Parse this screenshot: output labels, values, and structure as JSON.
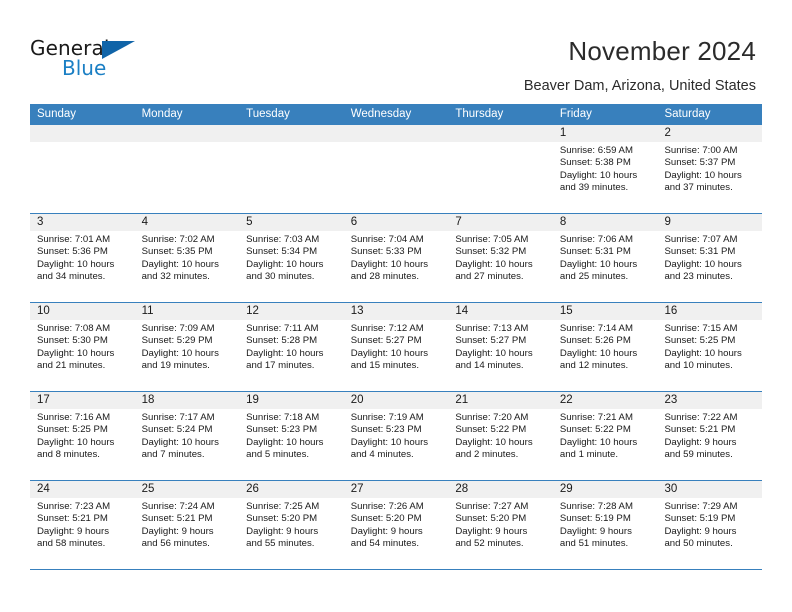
{
  "brand": {
    "word_one": "General",
    "word_two": "Blue",
    "triangle_color": "#1064a8",
    "blue_color": "#1b7fc4"
  },
  "header": {
    "title": "November 2024",
    "subtitle": "Beaver Dam, Arizona, United States"
  },
  "theme": {
    "header_blue": "#3880bd",
    "day_band_gray": "#f0f0f0"
  },
  "weekdays": [
    "Sunday",
    "Monday",
    "Tuesday",
    "Wednesday",
    "Thursday",
    "Friday",
    "Saturday"
  ],
  "labels": {
    "sunrise": "Sunrise:",
    "sunset": "Sunset:",
    "daylight": "Daylight:"
  },
  "weeks": [
    [
      {
        "date": "",
        "empty": true
      },
      {
        "date": "",
        "empty": true
      },
      {
        "date": "",
        "empty": true
      },
      {
        "date": "",
        "empty": true
      },
      {
        "date": "",
        "empty": true
      },
      {
        "date": "1",
        "sunrise": "Sunrise: 6:59 AM",
        "sunset": "Sunset: 5:38 PM",
        "daylight1": "Daylight: 10 hours",
        "daylight2": "and 39 minutes."
      },
      {
        "date": "2",
        "sunrise": "Sunrise: 7:00 AM",
        "sunset": "Sunset: 5:37 PM",
        "daylight1": "Daylight: 10 hours",
        "daylight2": "and 37 minutes."
      }
    ],
    [
      {
        "date": "3",
        "sunrise": "Sunrise: 7:01 AM",
        "sunset": "Sunset: 5:36 PM",
        "daylight1": "Daylight: 10 hours",
        "daylight2": "and 34 minutes."
      },
      {
        "date": "4",
        "sunrise": "Sunrise: 7:02 AM",
        "sunset": "Sunset: 5:35 PM",
        "daylight1": "Daylight: 10 hours",
        "daylight2": "and 32 minutes."
      },
      {
        "date": "5",
        "sunrise": "Sunrise: 7:03 AM",
        "sunset": "Sunset: 5:34 PM",
        "daylight1": "Daylight: 10 hours",
        "daylight2": "and 30 minutes."
      },
      {
        "date": "6",
        "sunrise": "Sunrise: 7:04 AM",
        "sunset": "Sunset: 5:33 PM",
        "daylight1": "Daylight: 10 hours",
        "daylight2": "and 28 minutes."
      },
      {
        "date": "7",
        "sunrise": "Sunrise: 7:05 AM",
        "sunset": "Sunset: 5:32 PM",
        "daylight1": "Daylight: 10 hours",
        "daylight2": "and 27 minutes."
      },
      {
        "date": "8",
        "sunrise": "Sunrise: 7:06 AM",
        "sunset": "Sunset: 5:31 PM",
        "daylight1": "Daylight: 10 hours",
        "daylight2": "and 25 minutes."
      },
      {
        "date": "9",
        "sunrise": "Sunrise: 7:07 AM",
        "sunset": "Sunset: 5:31 PM",
        "daylight1": "Daylight: 10 hours",
        "daylight2": "and 23 minutes."
      }
    ],
    [
      {
        "date": "10",
        "sunrise": "Sunrise: 7:08 AM",
        "sunset": "Sunset: 5:30 PM",
        "daylight1": "Daylight: 10 hours",
        "daylight2": "and 21 minutes."
      },
      {
        "date": "11",
        "sunrise": "Sunrise: 7:09 AM",
        "sunset": "Sunset: 5:29 PM",
        "daylight1": "Daylight: 10 hours",
        "daylight2": "and 19 minutes."
      },
      {
        "date": "12",
        "sunrise": "Sunrise: 7:11 AM",
        "sunset": "Sunset: 5:28 PM",
        "daylight1": "Daylight: 10 hours",
        "daylight2": "and 17 minutes."
      },
      {
        "date": "13",
        "sunrise": "Sunrise: 7:12 AM",
        "sunset": "Sunset: 5:27 PM",
        "daylight1": "Daylight: 10 hours",
        "daylight2": "and 15 minutes."
      },
      {
        "date": "14",
        "sunrise": "Sunrise: 7:13 AM",
        "sunset": "Sunset: 5:27 PM",
        "daylight1": "Daylight: 10 hours",
        "daylight2": "and 14 minutes."
      },
      {
        "date": "15",
        "sunrise": "Sunrise: 7:14 AM",
        "sunset": "Sunset: 5:26 PM",
        "daylight1": "Daylight: 10 hours",
        "daylight2": "and 12 minutes."
      },
      {
        "date": "16",
        "sunrise": "Sunrise: 7:15 AM",
        "sunset": "Sunset: 5:25 PM",
        "daylight1": "Daylight: 10 hours",
        "daylight2": "and 10 minutes."
      }
    ],
    [
      {
        "date": "17",
        "sunrise": "Sunrise: 7:16 AM",
        "sunset": "Sunset: 5:25 PM",
        "daylight1": "Daylight: 10 hours",
        "daylight2": "and 8 minutes."
      },
      {
        "date": "18",
        "sunrise": "Sunrise: 7:17 AM",
        "sunset": "Sunset: 5:24 PM",
        "daylight1": "Daylight: 10 hours",
        "daylight2": "and 7 minutes."
      },
      {
        "date": "19",
        "sunrise": "Sunrise: 7:18 AM",
        "sunset": "Sunset: 5:23 PM",
        "daylight1": "Daylight: 10 hours",
        "daylight2": "and 5 minutes."
      },
      {
        "date": "20",
        "sunrise": "Sunrise: 7:19 AM",
        "sunset": "Sunset: 5:23 PM",
        "daylight1": "Daylight: 10 hours",
        "daylight2": "and 4 minutes."
      },
      {
        "date": "21",
        "sunrise": "Sunrise: 7:20 AM",
        "sunset": "Sunset: 5:22 PM",
        "daylight1": "Daylight: 10 hours",
        "daylight2": "and 2 minutes."
      },
      {
        "date": "22",
        "sunrise": "Sunrise: 7:21 AM",
        "sunset": "Sunset: 5:22 PM",
        "daylight1": "Daylight: 10 hours",
        "daylight2": "and 1 minute."
      },
      {
        "date": "23",
        "sunrise": "Sunrise: 7:22 AM",
        "sunset": "Sunset: 5:21 PM",
        "daylight1": "Daylight: 9 hours",
        "daylight2": "and 59 minutes."
      }
    ],
    [
      {
        "date": "24",
        "sunrise": "Sunrise: 7:23 AM",
        "sunset": "Sunset: 5:21 PM",
        "daylight1": "Daylight: 9 hours",
        "daylight2": "and 58 minutes."
      },
      {
        "date": "25",
        "sunrise": "Sunrise: 7:24 AM",
        "sunset": "Sunset: 5:21 PM",
        "daylight1": "Daylight: 9 hours",
        "daylight2": "and 56 minutes."
      },
      {
        "date": "26",
        "sunrise": "Sunrise: 7:25 AM",
        "sunset": "Sunset: 5:20 PM",
        "daylight1": "Daylight: 9 hours",
        "daylight2": "and 55 minutes."
      },
      {
        "date": "27",
        "sunrise": "Sunrise: 7:26 AM",
        "sunset": "Sunset: 5:20 PM",
        "daylight1": "Daylight: 9 hours",
        "daylight2": "and 54 minutes."
      },
      {
        "date": "28",
        "sunrise": "Sunrise: 7:27 AM",
        "sunset": "Sunset: 5:20 PM",
        "daylight1": "Daylight: 9 hours",
        "daylight2": "and 52 minutes."
      },
      {
        "date": "29",
        "sunrise": "Sunrise: 7:28 AM",
        "sunset": "Sunset: 5:19 PM",
        "daylight1": "Daylight: 9 hours",
        "daylight2": "and 51 minutes."
      },
      {
        "date": "30",
        "sunrise": "Sunrise: 7:29 AM",
        "sunset": "Sunset: 5:19 PM",
        "daylight1": "Daylight: 9 hours",
        "daylight2": "and 50 minutes."
      }
    ]
  ]
}
